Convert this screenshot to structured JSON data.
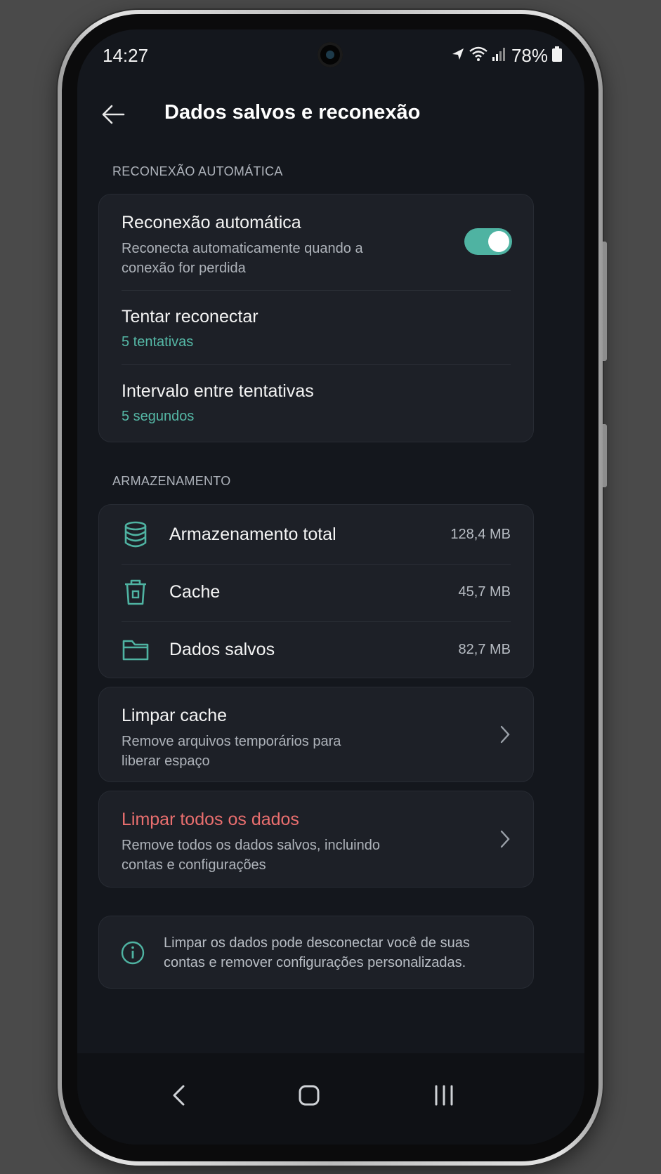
{
  "status_bar": {
    "time": "14:27",
    "battery": "78%"
  },
  "header": {
    "title": "Dados salvos e reconexão"
  },
  "reconnect_section": {
    "label": "RECONEXÃO AUTOMÁTICA",
    "auto_reconnect": {
      "title": "Reconexão automática",
      "desc_line1": "Reconecta automaticamente quando a",
      "desc_line2": "conexão for perdida",
      "enabled": true
    },
    "retry": {
      "title": "Tentar reconectar",
      "value": "5 tentativas"
    },
    "interval": {
      "title": "Intervalo entre tentativas",
      "value": "5 segundos"
    }
  },
  "storage_section": {
    "label": "ARMAZENAMENTO",
    "items": [
      {
        "icon": "database-icon",
        "label": "Armazenamento total",
        "size": "128,4 MB"
      },
      {
        "icon": "trash-icon",
        "label": "Cache",
        "size": "45,7 MB"
      },
      {
        "icon": "folder-icon",
        "label": "Dados salvos",
        "size": "82,7 MB"
      }
    ]
  },
  "clear_cache": {
    "title": "Limpar cache",
    "desc_line1": "Remove arquivos temporários para",
    "desc_line2": "liberar espaço"
  },
  "clear_all": {
    "title": "Limpar todos os dados",
    "desc_line1": "Remove todos os dados salvos, incluindo",
    "desc_line2": "contas e configurações"
  },
  "info": {
    "icon": "info-icon",
    "line1": "Limpar os dados pode desconectar você de suas",
    "line2": "contas e remover configurações personalizadas."
  },
  "colors": {
    "accent": "#4fb3a2",
    "danger": "#ea6f6f",
    "background": "#14171d",
    "card": "#1d2027"
  },
  "nav": {
    "back": "back-nav-icon",
    "home": "home-nav-icon",
    "recents": "recents-nav-icon"
  }
}
